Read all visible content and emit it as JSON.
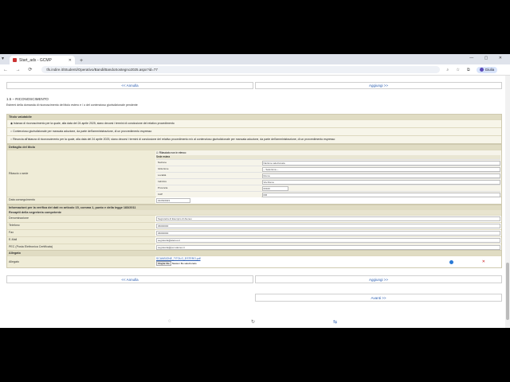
{
  "browser": {
    "tab_title": "Start_ads - GCMP",
    "new_tab": "+",
    "url": "tfs.indire.it/Studenti/Operativo/Bandi/BandoSostegno2025.aspx?id=77",
    "profile_label": "Giulia",
    "window_controls": "— ▢ ✕",
    "nav": "← → ⟳"
  },
  "nav_top": {
    "back": "<< Annulla",
    "next": "Aggiungi >>"
  },
  "section": {
    "title": "1.5 – RICONOSCIMENTO",
    "description": "Estremi della domanda di riconoscimento del titolo estero e / o del contenzioso giurisdizionale pendente"
  },
  "titolo_valutabile": {
    "header": "Titolo valutabile",
    "options": [
      "Istanza di riconoscimento per la quale, alla data del 24 aprile 2025, siano decorsi i termini di conclusione del relativo procedimento",
      "Contenzioso giurisdizionale per mancata adozione, da parte dell'amministrazione, di un provvedimento espresso",
      "Rinuncia all'istanza di riconoscimento per la quale, alla data del 24 aprile 2025, siano decorsi i termini di conclusione del relativo procedimento e/o al contenzioso giurisdizionale per mancata adozione, da parte dell'amministrazione, di un provvedimento espresso"
    ]
  },
  "dettaglio": {
    "header": "Dettaglio del titolo",
    "rilascio_label": "Rilascio o sede",
    "checkbox_label": "Rilasciato non in elenco",
    "sede_estera_label": "Sede estera",
    "sub_labels": [
      "Nazione",
      "Istituzione",
      "Località",
      "Indirizzo",
      "Provincia",
      "CAP"
    ],
    "sub_values": [
      "Nazione selezionata",
      "-- Seleziona --",
      "Roma",
      "Via Roma",
      "00100",
      "RM"
    ],
    "data_label": "Data conseguimento",
    "data_value": "01/06/2023"
  },
  "info": {
    "header": "Informazioni per la verifica dei dati ex articolo 15, comma 1, punto e della legge 183/2011",
    "sub_header": "Recapiti della segreteria competente",
    "labels": [
      "Denominazione",
      "Telefono",
      "Fax",
      "E-Mail",
      "PEC (Posta Elettronica Certificata)"
    ],
    "values": [
      "Segreteria di Esempio di Ateneo",
      "06000000",
      "06000000",
      "segreteria@ateneo.it",
      "segreteria@pec.ateneo.it"
    ]
  },
  "allegato": {
    "header": "Allegato",
    "label": "Allegato",
    "file_link": "SCANSIONE_TITOLO_ESTERO.pdf",
    "browse_label": "Sfoglia File",
    "no_file": "Nessun file selezionato",
    "remove": "✕"
  },
  "nav_bottom": {
    "back": "<< Annulla",
    "next": "Aggiungi >>",
    "forward": "Avanti >>"
  },
  "colors": {
    "accent": "#2a5db0",
    "panel": "#f2efdd"
  }
}
